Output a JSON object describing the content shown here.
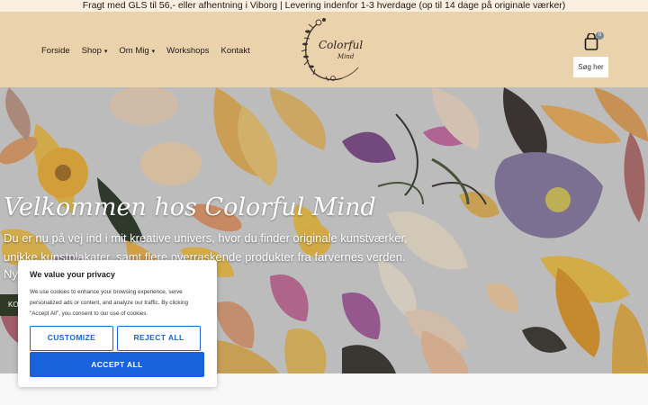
{
  "announcement": "Fragt med GLS til 56,- eller afhentning i Viborg   |   Levering indenfor 1-3 hverdage (op til 14 dage på originale værker)",
  "nav": [
    {
      "label": "Forside",
      "has_dropdown": false
    },
    {
      "label": "Shop",
      "has_dropdown": true
    },
    {
      "label": "Om Mig",
      "has_dropdown": true
    },
    {
      "label": "Workshops",
      "has_dropdown": false
    },
    {
      "label": "Kontakt",
      "has_dropdown": false
    }
  ],
  "logo": {
    "text": "Colorful",
    "subtext": "Mind"
  },
  "cart": {
    "count": "0",
    "icon": "shopping-bag-icon"
  },
  "search_button": "Søg her",
  "hero": {
    "title": "Velkommen hos Colorful Mind",
    "text_line1": "Du er nu på vej ind i mit kreative univers, hvor du finder originale kunstværker,",
    "text_line2": "unikke kunstplakater, samt flere overraskende produkter fra farvernes verden.",
    "text_line3": "Ny",
    "cta_label": "KO"
  },
  "cookie": {
    "title": "We value your privacy",
    "text": "We use cookies to enhance your browsing experience, serve personalized ads or content, and analyze our traffic. By clicking \"Accept All\", you consent to our use of cookies.",
    "customize": "CUSTOMIZE",
    "reject": "REJECT ALL",
    "accept": "ACCEPT ALL"
  },
  "colors": {
    "topbar": "#fbefe1",
    "header": "#ead2ac",
    "accent": "#1863dc",
    "cta": "#2f3a25"
  }
}
